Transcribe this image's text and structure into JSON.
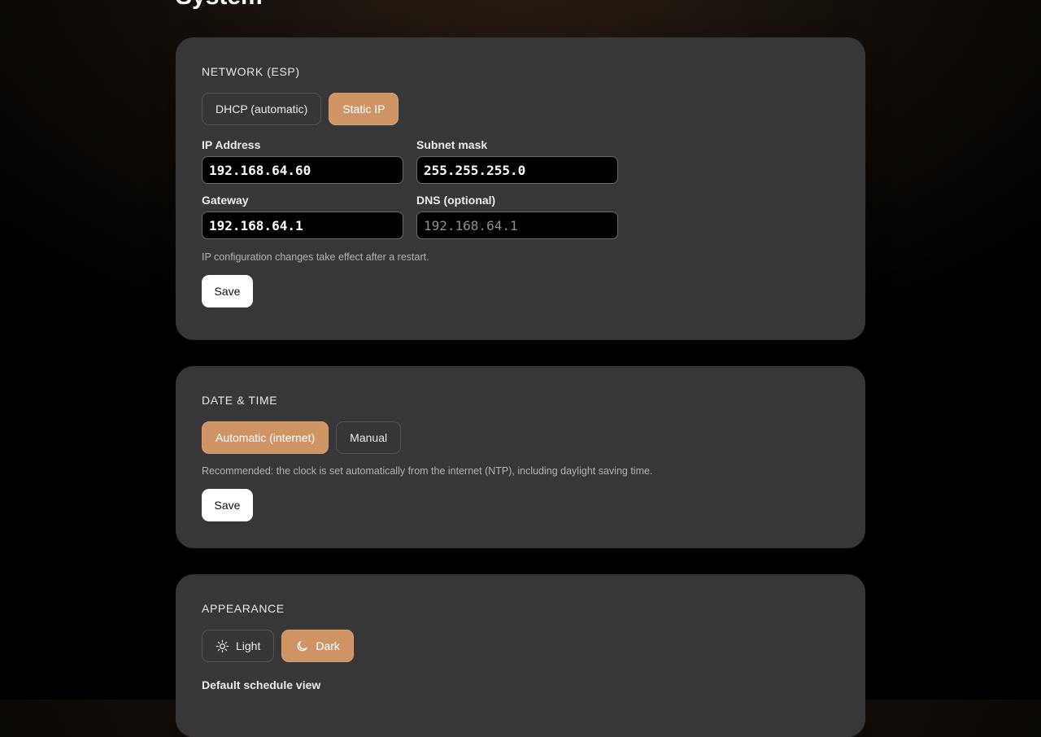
{
  "page": {
    "title": "System"
  },
  "network": {
    "title": "NETWORK (ESP)",
    "modes": [
      {
        "label": "DHCP (automatic)",
        "active": false
      },
      {
        "label": "Static IP",
        "active": true
      }
    ],
    "fields": {
      "ip": {
        "label": "IP Address",
        "value": "192.168.64.60",
        "placeholder": ""
      },
      "subnet": {
        "label": "Subnet mask",
        "value": "255.255.255.0",
        "placeholder": ""
      },
      "gateway": {
        "label": "Gateway",
        "value": "192.168.64.1",
        "placeholder": ""
      },
      "dns": {
        "label": "DNS (optional)",
        "value": "",
        "placeholder": "192.168.64.1"
      }
    },
    "hint": "IP configuration changes take effect after a restart.",
    "save_label": "Save"
  },
  "datetime": {
    "title": "DATE & TIME",
    "modes": [
      {
        "label": "Automatic (internet)",
        "active": true
      },
      {
        "label": "Manual",
        "active": false
      }
    ],
    "hint": "Recommended: the clock is set automatically from the internet (NTP), including daylight saving time.",
    "save_label": "Save"
  },
  "appearance": {
    "title": "APPEARANCE",
    "modes": [
      {
        "label": "Light",
        "icon": "sun-icon",
        "active": false
      },
      {
        "label": "Dark",
        "icon": "moon-icon",
        "active": true
      }
    ],
    "default_view_label": "Default schedule view"
  },
  "colors": {
    "accent": "#cf9464",
    "card": "#373737",
    "input_bg": "#000000"
  }
}
